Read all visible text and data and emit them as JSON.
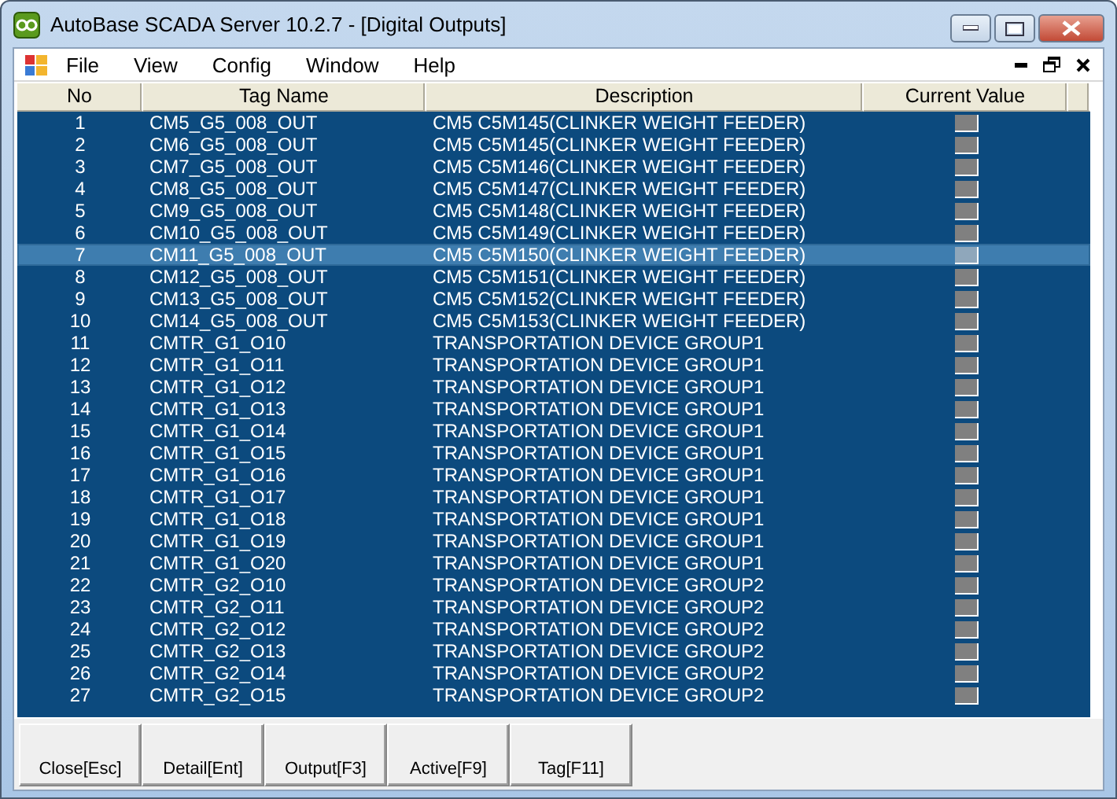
{
  "window": {
    "title": "AutoBase SCADA Server 10.2.7 - [Digital Outputs]"
  },
  "menu": [
    "File",
    "View",
    "Config",
    "Window",
    "Help"
  ],
  "table": {
    "columns": [
      "No",
      "Tag Name",
      "Description",
      "Current Value"
    ],
    "rows": [
      {
        "no": "1",
        "tag": "CM5_G5_008_OUT",
        "description": "CM5 C5M145(CLINKER WEIGHT FEEDER)",
        "on": false,
        "selected": false
      },
      {
        "no": "2",
        "tag": "CM6_G5_008_OUT",
        "description": "CM5 C5M145(CLINKER WEIGHT FEEDER)",
        "on": false,
        "selected": false
      },
      {
        "no": "3",
        "tag": "CM7_G5_008_OUT",
        "description": "CM5 C5M146(CLINKER WEIGHT FEEDER)",
        "on": false,
        "selected": false
      },
      {
        "no": "4",
        "tag": "CM8_G5_008_OUT",
        "description": "CM5 C5M147(CLINKER WEIGHT FEEDER)",
        "on": false,
        "selected": false
      },
      {
        "no": "5",
        "tag": "CM9_G5_008_OUT",
        "description": "CM5 C5M148(CLINKER WEIGHT FEEDER)",
        "on": false,
        "selected": false
      },
      {
        "no": "6",
        "tag": "CM10_G5_008_OUT",
        "description": "CM5 C5M149(CLINKER WEIGHT FEEDER)",
        "on": false,
        "selected": false
      },
      {
        "no": "7",
        "tag": "CM11_G5_008_OUT",
        "description": "CM5 C5M150(CLINKER WEIGHT FEEDER)",
        "on": false,
        "selected": true
      },
      {
        "no": "8",
        "tag": "CM12_G5_008_OUT",
        "description": "CM5 C5M151(CLINKER WEIGHT FEEDER)",
        "on": false,
        "selected": false
      },
      {
        "no": "9",
        "tag": "CM13_G5_008_OUT",
        "description": "CM5 C5M152(CLINKER WEIGHT FEEDER)",
        "on": false,
        "selected": false
      },
      {
        "no": "10",
        "tag": "CM14_G5_008_OUT",
        "description": "CM5 C5M153(CLINKER WEIGHT FEEDER)",
        "on": false,
        "selected": false
      },
      {
        "no": "11",
        "tag": "CMTR_G1_O10",
        "description": "TRANSPORTATION DEVICE GROUP1",
        "on": false,
        "selected": false
      },
      {
        "no": "12",
        "tag": "CMTR_G1_O11",
        "description": "TRANSPORTATION DEVICE GROUP1",
        "on": false,
        "selected": false
      },
      {
        "no": "13",
        "tag": "CMTR_G1_O12",
        "description": "TRANSPORTATION DEVICE GROUP1",
        "on": false,
        "selected": false
      },
      {
        "no": "14",
        "tag": "CMTR_G1_O13",
        "description": "TRANSPORTATION DEVICE GROUP1",
        "on": false,
        "selected": false
      },
      {
        "no": "15",
        "tag": "CMTR_G1_O14",
        "description": "TRANSPORTATION DEVICE GROUP1",
        "on": false,
        "selected": false
      },
      {
        "no": "16",
        "tag": "CMTR_G1_O15",
        "description": "TRANSPORTATION DEVICE GROUP1",
        "on": false,
        "selected": false
      },
      {
        "no": "17",
        "tag": "CMTR_G1_O16",
        "description": "TRANSPORTATION DEVICE GROUP1",
        "on": false,
        "selected": false
      },
      {
        "no": "18",
        "tag": "CMTR_G1_O17",
        "description": "TRANSPORTATION DEVICE GROUP1",
        "on": false,
        "selected": false
      },
      {
        "no": "19",
        "tag": "CMTR_G1_O18",
        "description": "TRANSPORTATION DEVICE GROUP1",
        "on": false,
        "selected": false
      },
      {
        "no": "20",
        "tag": "CMTR_G1_O19",
        "description": "TRANSPORTATION DEVICE GROUP1",
        "on": false,
        "selected": false
      },
      {
        "no": "21",
        "tag": "CMTR_G1_O20",
        "description": "TRANSPORTATION DEVICE GROUP1",
        "on": false,
        "selected": false
      },
      {
        "no": "22",
        "tag": "CMTR_G2_O10",
        "description": "TRANSPORTATION DEVICE GROUP2",
        "on": false,
        "selected": false
      },
      {
        "no": "23",
        "tag": "CMTR_G2_O11",
        "description": "TRANSPORTATION DEVICE GROUP2",
        "on": false,
        "selected": false
      },
      {
        "no": "24",
        "tag": "CMTR_G2_O12",
        "description": "TRANSPORTATION DEVICE GROUP2",
        "on": false,
        "selected": false
      },
      {
        "no": "25",
        "tag": "CMTR_G2_O13",
        "description": "TRANSPORTATION DEVICE GROUP2",
        "on": false,
        "selected": false
      },
      {
        "no": "26",
        "tag": "CMTR_G2_O14",
        "description": "TRANSPORTATION DEVICE GROUP2",
        "on": false,
        "selected": false
      },
      {
        "no": "27",
        "tag": "CMTR_G2_O15",
        "description": "TRANSPORTATION DEVICE GROUP2",
        "on": false,
        "selected": false
      }
    ]
  },
  "buttons": [
    "Close[Esc]",
    "Detail[Ent]",
    "Output[F3]",
    "Active[F9]",
    "Tag[F11]"
  ]
}
